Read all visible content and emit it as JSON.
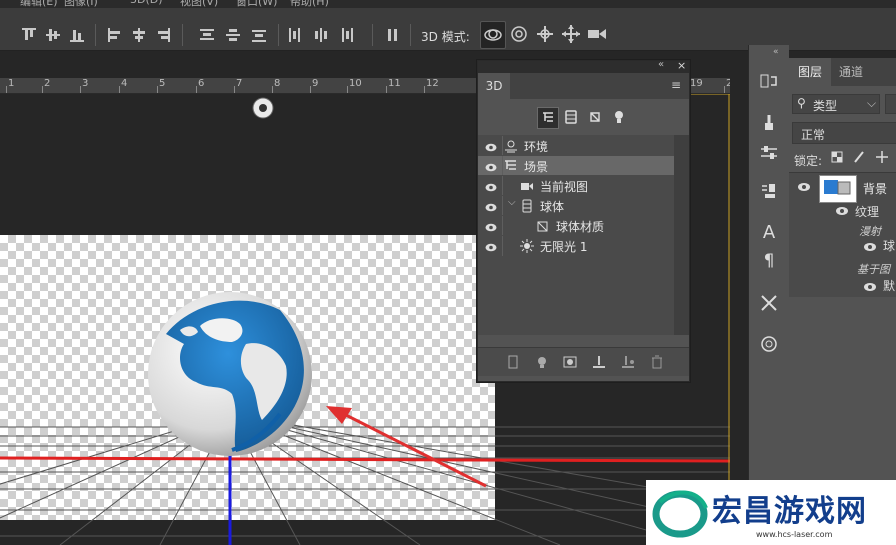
{
  "options_bar": {
    "mode_label": "3D 模式:"
  },
  "ruler": {
    "ticks": [
      "1",
      "2",
      "3",
      "4",
      "5",
      "6",
      "7",
      "8",
      "9",
      "10",
      "11",
      "12",
      "19",
      "2"
    ]
  },
  "panel_3d": {
    "tab_label": "3D",
    "items": [
      {
        "label": "环境",
        "icon": "environment-icon",
        "eye": true,
        "selected": false,
        "indent": 0
      },
      {
        "label": "场景",
        "icon": "scene-icon",
        "eye": true,
        "selected": true,
        "indent": 0
      },
      {
        "label": "当前视图",
        "icon": "camera-icon",
        "eye": true,
        "selected": false,
        "indent": 1
      },
      {
        "label": "球体",
        "icon": "mesh-icon",
        "eye": true,
        "selected": false,
        "indent": 1
      },
      {
        "label": "球体材质",
        "icon": "material-icon",
        "eye": false,
        "selected": false,
        "indent": 2
      },
      {
        "label": "无限光 1",
        "icon": "light-icon",
        "eye": true,
        "selected": false,
        "indent": 1
      }
    ]
  },
  "layers_panel": {
    "tabs": [
      "图层",
      "通道"
    ],
    "filter_label": "类型",
    "blend_mode": "正常",
    "lock_label": "锁定:",
    "layer_name": "背景",
    "sub_texture": "纹理",
    "sub_diffuse": "漫射",
    "sub_ball": "球",
    "sub_image_based": "基于图",
    "sub_default": "默"
  },
  "watermark": {
    "text": "宏昌游戏网",
    "url": "www.hcs-laser.com"
  },
  "colors": {
    "accent_red": "#e02020",
    "axis_blue": "#1a1ae0",
    "globe_blue": "#1e78c8"
  }
}
